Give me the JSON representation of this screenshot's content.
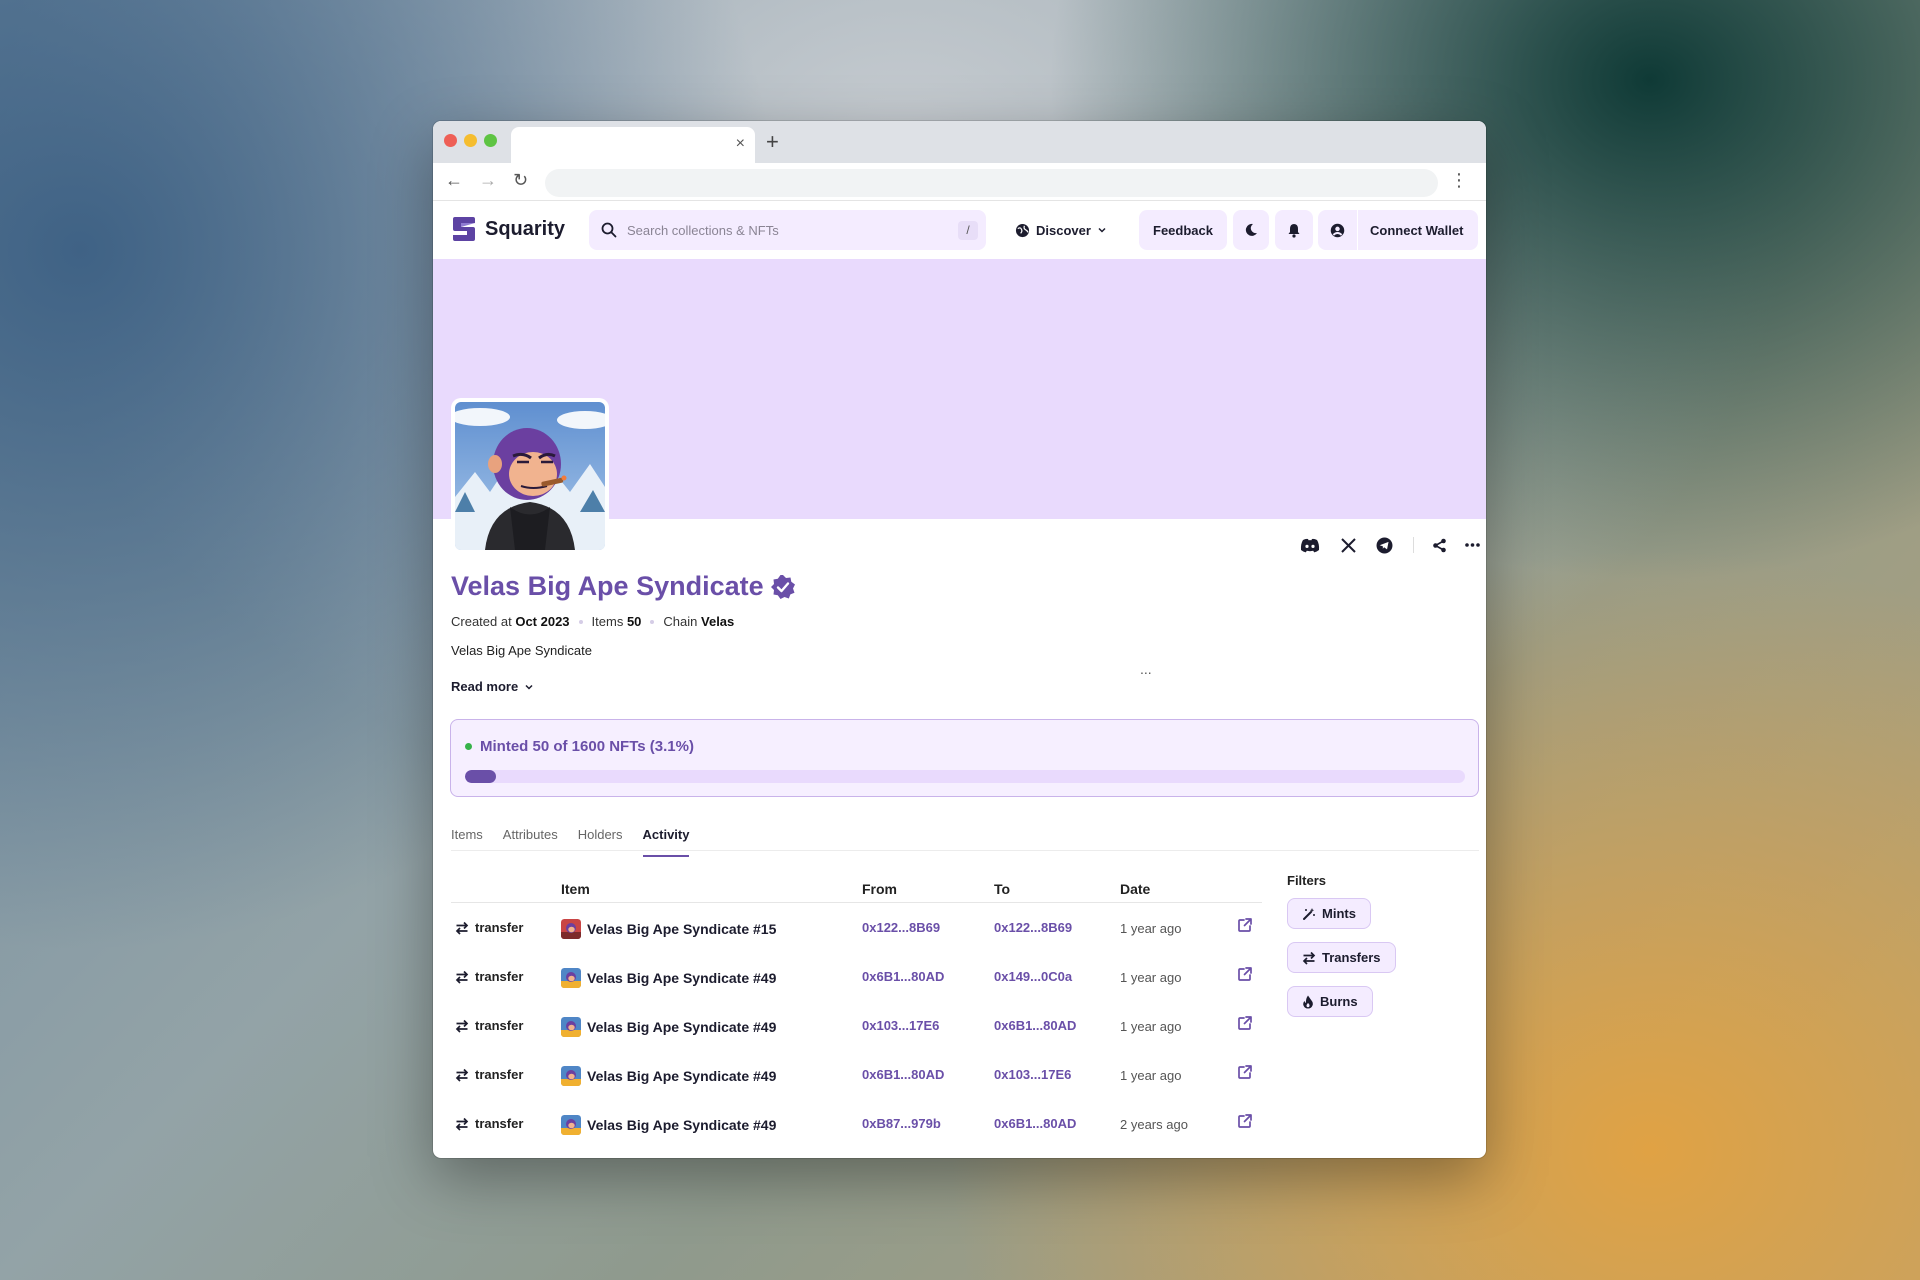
{
  "browser": {
    "tab_close": "×",
    "new_tab": "+",
    "back": "←",
    "forward": "→",
    "reload": "↻",
    "menu": "⋮"
  },
  "header": {
    "brand": "Squarity",
    "search_placeholder": "Search collections & NFTs",
    "search_shortcut": "/",
    "discover_label": "Discover",
    "feedback_label": "Feedback",
    "connect_wallet_label": "Connect Wallet"
  },
  "collection": {
    "name": "Velas Big Ape Syndicate",
    "created_label": "Created at",
    "created_value": "Oct 2023",
    "items_label": "Items",
    "items_value": "50",
    "chain_label": "Chain",
    "chain_value": "Velas",
    "description": "Velas Big Ape Syndicate",
    "ellipsis": "...",
    "read_more": "Read more"
  },
  "mint": {
    "text": "Minted 50 of 1600 NFTs (3.1%)",
    "progress_fraction": 0.031
  },
  "tabs": [
    {
      "label": "Items",
      "active": false
    },
    {
      "label": "Attributes",
      "active": false
    },
    {
      "label": "Holders",
      "active": false
    },
    {
      "label": "Activity",
      "active": true
    }
  ],
  "activity": {
    "headers": {
      "item": "Item",
      "from": "From",
      "to": "To",
      "date": "Date"
    },
    "rows": [
      {
        "type": "transfer",
        "item": "Velas Big Ape Syndicate #15",
        "from": "0x122...8B69",
        "to": "0x122...8B69",
        "date": "1 year ago",
        "thumb": "red"
      },
      {
        "type": "transfer",
        "item": "Velas Big Ape Syndicate #49",
        "from": "0x6B1...80AD",
        "to": "0x149...0C0a",
        "date": "1 year ago",
        "thumb": "blue"
      },
      {
        "type": "transfer",
        "item": "Velas Big Ape Syndicate #49",
        "from": "0x103...17E6",
        "to": "0x6B1...80AD",
        "date": "1 year ago",
        "thumb": "blue"
      },
      {
        "type": "transfer",
        "item": "Velas Big Ape Syndicate #49",
        "from": "0x6B1...80AD",
        "to": "0x103...17E6",
        "date": "1 year ago",
        "thumb": "blue"
      },
      {
        "type": "transfer",
        "item": "Velas Big Ape Syndicate #49",
        "from": "0xB87...979b",
        "to": "0x6B1...80AD",
        "date": "2 years ago",
        "thumb": "blue"
      }
    ]
  },
  "filters": {
    "title": "Filters",
    "chips": [
      "Mints",
      "Transfers",
      "Burns"
    ]
  },
  "colors": {
    "accent": "#6a4fa8",
    "banner": "#e9dafd",
    "soft_button": "#f4ecff",
    "mint_dot": "#36b24a"
  },
  "icons": {
    "search": "search-icon",
    "globe": "globe-icon",
    "moon": "moon-icon",
    "bell": "bell-icon",
    "account": "user-circle-icon",
    "discord": "discord-icon",
    "x": "x-logo-icon",
    "telegram": "telegram-icon",
    "share": "share-icon",
    "more": "more-horizontal-icon",
    "transfer": "arrows-swap-icon",
    "external": "external-link-icon",
    "mints": "magic-wand-icon",
    "burns": "flame-icon",
    "verified": "verified-badge-icon"
  }
}
